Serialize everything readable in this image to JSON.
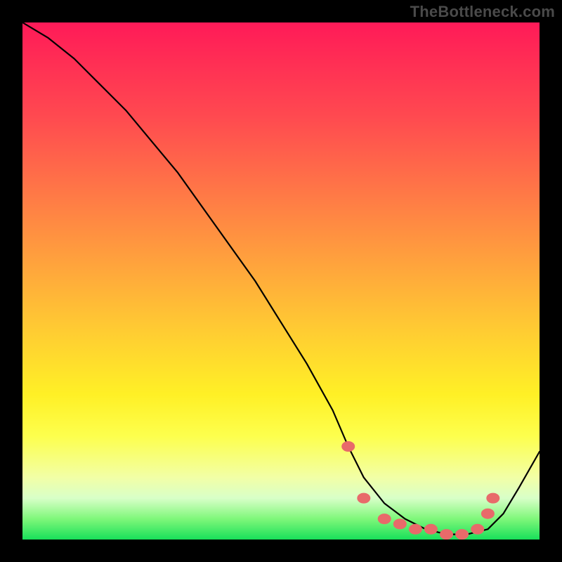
{
  "watermark": "TheBottleneck.com",
  "chart_data": {
    "type": "line",
    "title": "",
    "xlabel": "",
    "ylabel": "",
    "xlim": [
      0,
      100
    ],
    "ylim": [
      0,
      100
    ],
    "grid": false,
    "legend": false,
    "series": [
      {
        "name": "bottleneck-curve",
        "x": [
          0,
          5,
          10,
          15,
          20,
          25,
          30,
          35,
          40,
          45,
          50,
          55,
          60,
          63,
          66,
          70,
          74,
          78,
          82,
          86,
          90,
          93,
          96,
          100
        ],
        "y": [
          100,
          97,
          93,
          88,
          83,
          77,
          71,
          64,
          57,
          50,
          42,
          34,
          25,
          18,
          12,
          7,
          4,
          2,
          1,
          1,
          2,
          5,
          10,
          17
        ]
      }
    ],
    "markers": {
      "name": "optimal-range",
      "x": [
        63,
        66,
        70,
        73,
        76,
        79,
        82,
        85,
        88,
        90,
        91
      ],
      "y": [
        18,
        8,
        4,
        3,
        2,
        2,
        1,
        1,
        2,
        5,
        8
      ]
    },
    "background_gradient": {
      "top_color": "#ff1a58",
      "bottom_color": "#18e05a",
      "description": "red (high bottleneck) to green (low bottleneck)"
    }
  }
}
